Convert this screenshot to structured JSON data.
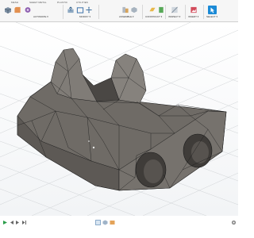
{
  "toolbar": {
    "tabs": [
      "MESH",
      "SHEET METAL",
      "PLASTIC",
      "UTILITIES"
    ],
    "groups": [
      "AUTOMATE",
      "MODIFY",
      "ASSEMBLE",
      "CONSTRUCT",
      "INSPECT",
      "INSERT",
      "SELECT"
    ],
    "icons": [
      "cube-icon",
      "fillet-icon",
      "automate-icon",
      "press-pull-icon",
      "shell-icon",
      "move-icon",
      "joint-icon",
      "assemble-icon",
      "plane-icon",
      "measure-icon",
      "section-icon",
      "insert-image-icon",
      "select-arrow-icon"
    ],
    "accent": "#1b8ad6"
  },
  "viewport": {
    "model": "triangulated mesh bracket with two bores and saddle slot",
    "model_color": "#6f6b66",
    "edge_color": "#1c1c1c"
  },
  "statusbar": {
    "icons": [
      "play-icon",
      "prev-icon",
      "next-icon",
      "end-icon",
      "timeline-sketch-icon",
      "timeline-mesh-icon",
      "timeline-body-icon",
      "settings-icon"
    ]
  }
}
